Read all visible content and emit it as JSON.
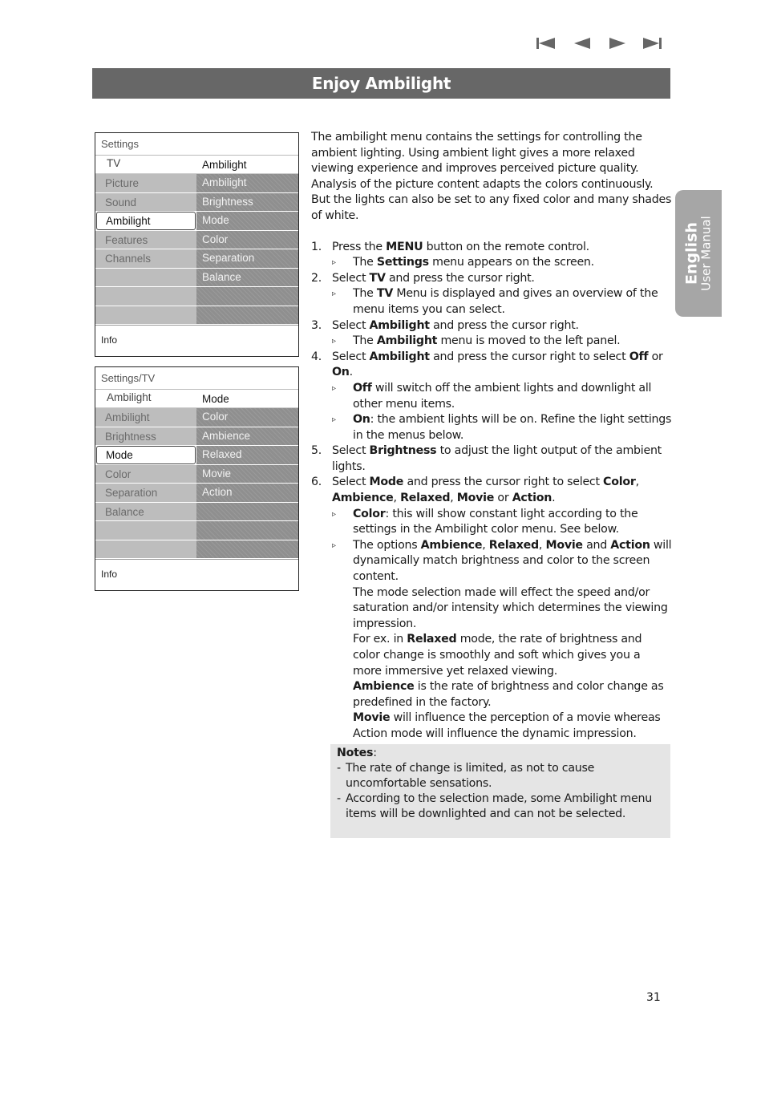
{
  "nav": {
    "icons": [
      "first-page-icon",
      "previous-page-icon",
      "next-page-icon",
      "last-page-icon"
    ],
    "color": "#666666"
  },
  "header": {
    "title": "Enjoy Ambilight",
    "background": "#676767"
  },
  "side_tab": {
    "language": "English",
    "subtitle": "User Manual",
    "background": "#a6a6a6"
  },
  "menus": [
    {
      "header": "Settings",
      "left_title": "TV",
      "right_title": "Ambilight",
      "left_items": [
        "Picture",
        "Sound",
        "Ambilight",
        "Features",
        "Channels",
        "",
        ""
      ],
      "selected_index": 2,
      "right_items": [
        "Ambilight",
        "Brightness",
        "Mode",
        "Color",
        "Separation",
        "Balance",
        "",
        ""
      ],
      "footer": "Info"
    },
    {
      "header": "Settings/TV",
      "left_title": "Ambilight",
      "right_title": "Mode",
      "left_items": [
        "Ambilight",
        "Brightness",
        "Mode",
        "Color",
        "Separation",
        "Balance",
        "",
        ""
      ],
      "selected_index": 2,
      "right_items": [
        "Color",
        "Ambience",
        "Relaxed",
        "Movie",
        "Action",
        "",
        "",
        ""
      ],
      "footer": "Info"
    }
  ],
  "intro": "The ambilight menu contains the settings for controlling the ambient lighting. Using ambient light gives a more relaxed viewing experience and improves perceived picture quality. Analysis of the picture content adapts the colors continuously. But the lights can also be set to any fixed color and many shades of white.",
  "steps": {
    "s1": {
      "num": "1.",
      "a": "Press the ",
      "b": "MENU",
      "c": " button on the remote control."
    },
    "s1r": {
      "a": "The ",
      "b": "Settings",
      "c": " menu appears on the screen."
    },
    "s2": {
      "num": "2.",
      "a": "Select ",
      "b": "TV",
      "c": " and press the cursor right."
    },
    "s2r": {
      "a": "The ",
      "b": "TV",
      "c": " Menu is displayed and gives an overview of the menu items you can select."
    },
    "s3": {
      "num": "3.",
      "a": "Select ",
      "b": "Ambilight",
      "c": " and press the cursor right."
    },
    "s3r": {
      "a": "The ",
      "b": "Ambilight",
      "c": " menu is moved to the left panel."
    },
    "s4": {
      "num": "4.",
      "a": "Select ",
      "b": "Ambilight",
      "c": " and press the cursor right to select ",
      "d": "Off",
      "e": " or ",
      "f": "On",
      "g": "."
    },
    "s4r1": {
      "b": "Off",
      "c": " will switch off the ambient lights and downlight all other menu items."
    },
    "s4r2": {
      "b": "On",
      "c": ": the ambient lights will be on. Refine the light settings in the menus below."
    },
    "s5": {
      "num": "5.",
      "a": "Select ",
      "b": "Brightness",
      "c": " to adjust the light output of the ambient lights."
    },
    "s6": {
      "num": "6.",
      "a": "Select ",
      "b": "Mode",
      "c": " and press the cursor right to select ",
      "d": "Color",
      "e": ", ",
      "f": "Ambience",
      "g": ", ",
      "h": "Relaxed",
      "i": ", ",
      "j": "Movie",
      "k": " or ",
      "l": "Action",
      "m": "."
    },
    "s6r1": {
      "b": "Color",
      "c": ": this will show constant light according to the settings in the Ambilight color menu. See below."
    },
    "s6r2": {
      "a": "The options ",
      "b": "Ambience",
      "c": ", ",
      "d": "Relaxed",
      "e": ", ",
      "f": "Movie",
      "g": " and ",
      "h": "Action",
      "i": " will dynamically match brightness and color to the screen content."
    },
    "s6p1": "The mode selection made will effect the speed and/or saturation and/or intensity which determines the viewing impression.",
    "s6p2": {
      "a": "For ex. in ",
      "b": "Relaxed",
      "c": " mode, the rate of brightness and color change is smoothly and soft which gives you a more immersive yet relaxed viewing."
    },
    "s6p3": {
      "b": "Ambience",
      "c": " is the rate of brightness and color change as predefined in the factory."
    },
    "s6p4": {
      "b": "Movie",
      "c": " will influence the perception of a movie whereas Action mode will influence the dynamic impression."
    }
  },
  "result_marker": "▹",
  "notes": {
    "title": "Notes",
    "colon": ":",
    "dash": "-",
    "items": [
      "The rate of change is limited, as not to cause uncomfortable sensations.",
      "According to the selection made, some Ambilight menu items will be downlighted and can not be selected."
    ],
    "background": "#e5e5e5"
  },
  "page_number": "31"
}
